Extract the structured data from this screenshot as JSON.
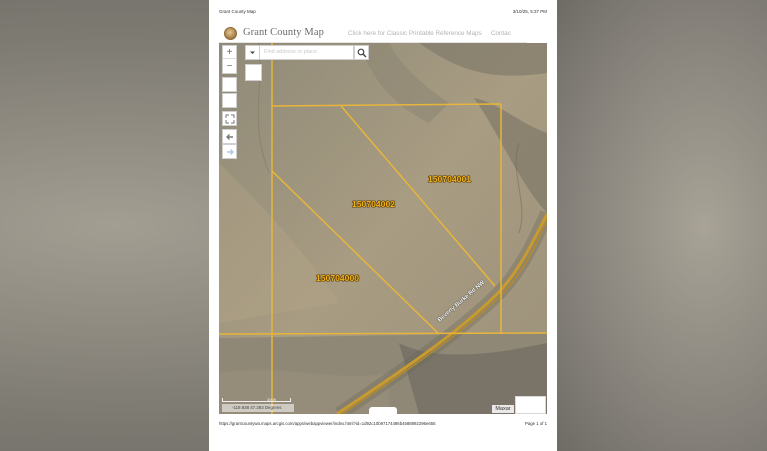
{
  "print": {
    "header_title": "Grant County Map",
    "header_datetime": "3/10/25, 5:37 PM",
    "footer_url": "https://grantcountywa.maps.arcgis.com/apps/webappviewer/index.html?id=1d92c10b97174486b4588892296e655",
    "footer_page": "Page 1 of 1"
  },
  "app": {
    "title": "Grant County Map",
    "classic_link": "Click here for Classic Printable Reference Maps",
    "contact_link": "Contac"
  },
  "search": {
    "placeholder": "Find address or place"
  },
  "map": {
    "parcels": [
      {
        "id": "150704001"
      },
      {
        "id": "150704002"
      },
      {
        "id": "150704000"
      }
    ],
    "road_label": "Beverly Burke Rd NW",
    "scale_label": "300ft",
    "coordinates": "-119.938 47.293 Degrees",
    "attribution": "Maxar"
  },
  "colors": {
    "parcel_line": "#e8b53a",
    "label_fill": "#f0b11e",
    "road": "#c99a2e"
  },
  "icons": [
    "zoom-in-icon",
    "zoom-out-icon",
    "fullscreen-icon",
    "back-arrow-icon",
    "forward-arrow-icon",
    "chevron-down-icon",
    "search-icon"
  ]
}
